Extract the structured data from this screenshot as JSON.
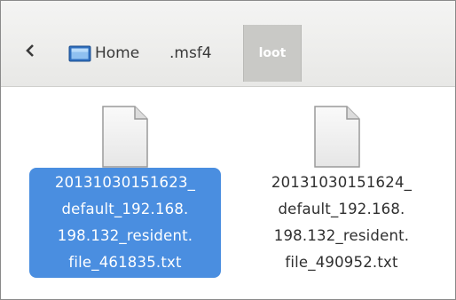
{
  "pathbar": {
    "back_icon": "chevron-left-icon",
    "crumbs": [
      {
        "label": "Home",
        "icon": "home-folder-icon"
      },
      {
        "label": ".msf4"
      },
      {
        "label": "loot",
        "active": true
      }
    ]
  },
  "files": [
    {
      "name": "20131030151623_\ndefault_192.168.\n198.132_resident.\nfile_461835.txt",
      "icon": "text-file-icon",
      "selected": true
    },
    {
      "name": "20131030151624_\ndefault_192.168.\n198.132_resident.\nfile_490952.txt",
      "icon": "text-file-icon",
      "selected": false
    }
  ],
  "colors": {
    "selection": "#4a8ee0",
    "active_crumb": "#c9c9c6"
  }
}
